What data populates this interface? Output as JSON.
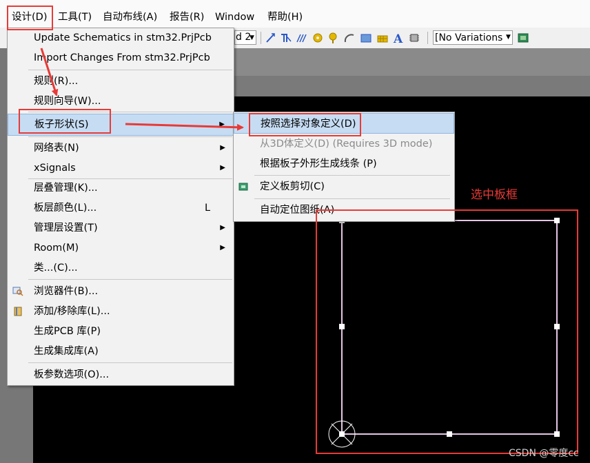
{
  "menubar": {
    "items": [
      {
        "label": "设计(D)",
        "key": "design"
      },
      {
        "label": "工具(T)",
        "key": "tools"
      },
      {
        "label": "自动布线(A)",
        "key": "autoroute"
      },
      {
        "label": "报告(R)",
        "key": "reports"
      },
      {
        "label": "Window",
        "key": "window"
      },
      {
        "label": "帮助(H)",
        "key": "help"
      }
    ]
  },
  "toolbar": {
    "partial_combo_text": "d 2",
    "variations_value": "[No Variations"
  },
  "design_menu": {
    "update_schematics": "Update Schematics in stm32.PrjPcb",
    "import_changes": "Import Changes From stm32.PrjPcb",
    "rules": "规则(R)...",
    "rules_wizard": "规则向导(W)...",
    "board_shape": "板子形状(S)",
    "netlist": "网络表(N)",
    "xsignals": "xSignals",
    "layer_stack": "层叠管理(K)...",
    "layer_colors": "板层颜色(L)...",
    "layer_colors_shortcut": "L",
    "layer_sets": "管理层设置(T)",
    "room": "Room(M)",
    "classes": "类...(C)...",
    "browse_components": "浏览器件(B)...",
    "add_remove_library": "添加/移除库(L)...",
    "make_pcb_library": "生成PCB 库(P)",
    "make_integrated_library": "生成集成库(A)",
    "board_options": "板参数选项(O)..."
  },
  "board_shape_menu": {
    "define_from_selected": "按照选择对象定义(D)",
    "define_from_3d": "从3D体定义(D) (Requires 3D mode)",
    "create_primitives": "根据板子外形生成线条 (P)",
    "define_board_cutout": "定义板剪切(C)",
    "auto_position_sheet": "自动定位图纸(A)"
  },
  "annotations": {
    "select_board_frame": "选中板框"
  },
  "watermark": "CSDN @零度cc",
  "colors": {
    "annotation_red": "#e83a36",
    "menu_highlight": "#c6dcf3",
    "canvas_background": "#000000",
    "board_outline": "#e6c6e6"
  }
}
